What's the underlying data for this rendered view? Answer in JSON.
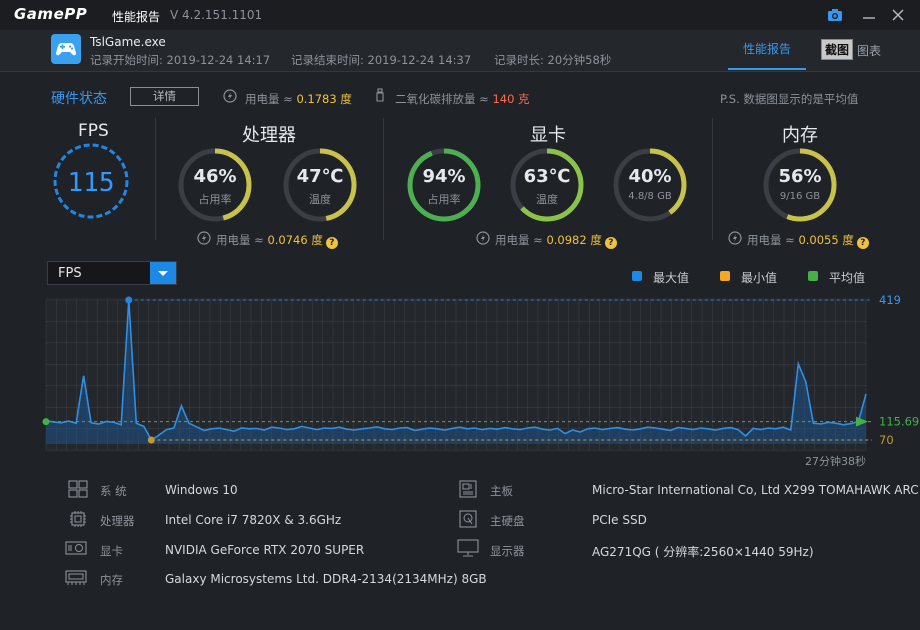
{
  "titlebar": {
    "logo": "GamePP",
    "title": "性能报告",
    "version": "V 4.2.151.1101"
  },
  "header": {
    "game_name": "TslGame.exe",
    "start_label": "记录开始时间: 2019-12-24 14:17",
    "end_label": "记录结束时间: 2019-12-24 14:37",
    "duration_label": "记录时长: 20分钟58秒",
    "tabs": [
      {
        "label": "性能报告",
        "active": true
      },
      {
        "label": "图表",
        "active": false
      }
    ],
    "screenshot_tip": "截图"
  },
  "hardware": {
    "title": "硬件状态",
    "detail_button": "详情",
    "power_label": "用电量 ≈",
    "power_value": "0.1783 度",
    "co2_label": "二氧化碳排放量 ≈",
    "co2_value": "140 克",
    "note": "P.S. 数据图显示的是平均值"
  },
  "fps": {
    "title": "FPS",
    "value": "115"
  },
  "cpu": {
    "title": "处理器",
    "usage": {
      "value": "46%",
      "label": "占用率",
      "fraction": 0.46
    },
    "temp": {
      "value": "47℃",
      "label": "温度",
      "fraction": 0.47
    },
    "power_label": "用电量 ≈",
    "power_value": "0.0746 度"
  },
  "gpu": {
    "title": "显卡",
    "usage": {
      "value": "94%",
      "label": "占用率",
      "fraction": 0.94
    },
    "temp": {
      "value": "63℃",
      "label": "温度",
      "fraction": 0.63
    },
    "vram": {
      "value": "40%",
      "label": "4.8/8 GB",
      "fraction": 0.4
    },
    "power_label": "用电量 ≈",
    "power_value": "0.0982 度"
  },
  "memory": {
    "title": "内存",
    "usage": {
      "value": "56%",
      "label": "9/16 GB",
      "fraction": 0.56
    },
    "power_label": "用电量 ≈",
    "power_value": "0.0055 度"
  },
  "chart_controls": {
    "metric": "FPS",
    "legend": [
      {
        "label": "最大值",
        "color": "#1e88e5"
      },
      {
        "label": "最小值",
        "color": "#f5a623"
      },
      {
        "label": "平均值",
        "color": "#43b049"
      }
    ]
  },
  "chart_data": {
    "type": "area",
    "max_label": "419",
    "avg_label": "115.69",
    "min_label": "70",
    "duration_label": "27分钟38秒",
    "max": 419,
    "avg": 115.69,
    "min": 70,
    "ylim": [
      70,
      419
    ],
    "values": [
      118,
      115,
      113,
      117,
      112,
      230,
      113,
      110,
      116,
      114,
      108,
      419,
      112,
      104,
      70,
      82,
      96,
      100,
      155,
      112,
      103,
      94,
      98,
      100,
      96,
      92,
      100,
      98,
      99,
      95,
      102,
      100,
      96,
      98,
      104,
      100,
      96,
      100,
      99,
      102,
      97,
      95,
      98,
      100,
      103,
      98,
      96,
      100,
      101,
      94,
      97,
      100,
      98,
      95,
      99,
      102,
      98,
      100,
      96,
      99,
      97,
      101,
      98,
      96,
      100,
      102,
      97,
      95,
      99,
      86,
      95,
      90,
      98,
      100,
      96,
      99,
      101,
      97,
      95,
      98,
      102,
      100,
      97,
      94,
      101,
      99,
      96,
      100,
      98,
      95,
      99,
      101,
      96,
      80,
      99,
      96,
      100,
      98,
      102,
      95,
      260,
      215,
      112,
      110,
      114,
      112,
      108,
      111,
      116,
      185
    ],
    "colors": {
      "max": "#1e88e5",
      "min": "#c49a2c",
      "avg": "#43b049",
      "line": "#2f8fe6",
      "fill": "#1d5c9a"
    }
  },
  "system": [
    {
      "key": "系 统",
      "value": "Windows 10",
      "icon": "windows-icon"
    },
    {
      "key": "处理器",
      "value": "Intel Core i7 7820X & 3.6GHz",
      "icon": "cpu-icon"
    },
    {
      "key": "显卡",
      "value": "NVIDIA GeForce RTX 2070 SUPER",
      "icon": "gpu-icon"
    },
    {
      "key": "内存",
      "value": "Galaxy Microsystems Ltd. DDR4-2134(2134MHz) 8GB",
      "icon": "ram-icon"
    },
    {
      "key": "主板",
      "value": "Micro-Star International Co, Ltd X299 TOMAHAWK ARC",
      "icon": "motherboard-icon"
    },
    {
      "key": "主硬盘",
      "value": "PCIe SSD",
      "icon": "disk-icon"
    },
    {
      "key": "显示器",
      "value": "AG271QG ( 分辨率:2560×1440 59Hz)",
      "icon": "monitor-icon"
    }
  ]
}
